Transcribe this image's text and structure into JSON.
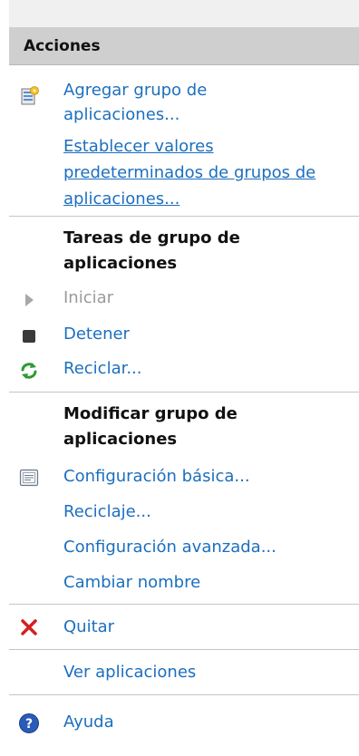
{
  "panel": {
    "header": "Acciones",
    "actions_top": {
      "add_pool": [
        "Agregar grupo de",
        "aplicaciones..."
      ],
      "set_defaults": [
        "Establecer valores ",
        "predeterminados de grupos de",
        "aplicaciones..."
      ]
    },
    "tasks_section": {
      "title": "Tareas de grupo de aplicaciones",
      "start": "Iniciar",
      "stop": "Detener",
      "recycle": "Reciclar..."
    },
    "modify_section": {
      "title": "Modificar grupo de aplicaciones",
      "basic_settings": "Configuración básica...",
      "recycling": "Reciclaje...",
      "advanced_settings": "Configuración avanzada...",
      "rename": "Cambiar nombre"
    },
    "remove": "Quitar",
    "view_applications": "Ver aplicaciones",
    "help": "Ayuda"
  },
  "icons": {
    "add_pool": "add-application-pool-icon",
    "start": "play-icon",
    "stop": "stop-icon",
    "recycle": "recycle-icon",
    "basic_settings": "settings-window-icon",
    "remove": "remove-x-icon",
    "help": "help-icon"
  },
  "colors": {
    "link": "#1c6fbe",
    "disabled": "#9a9a9a",
    "header_bg": "#cfcfcf",
    "remove": "#d42020",
    "recycle": "#2e9a2e",
    "help": "#2a5bb8"
  }
}
